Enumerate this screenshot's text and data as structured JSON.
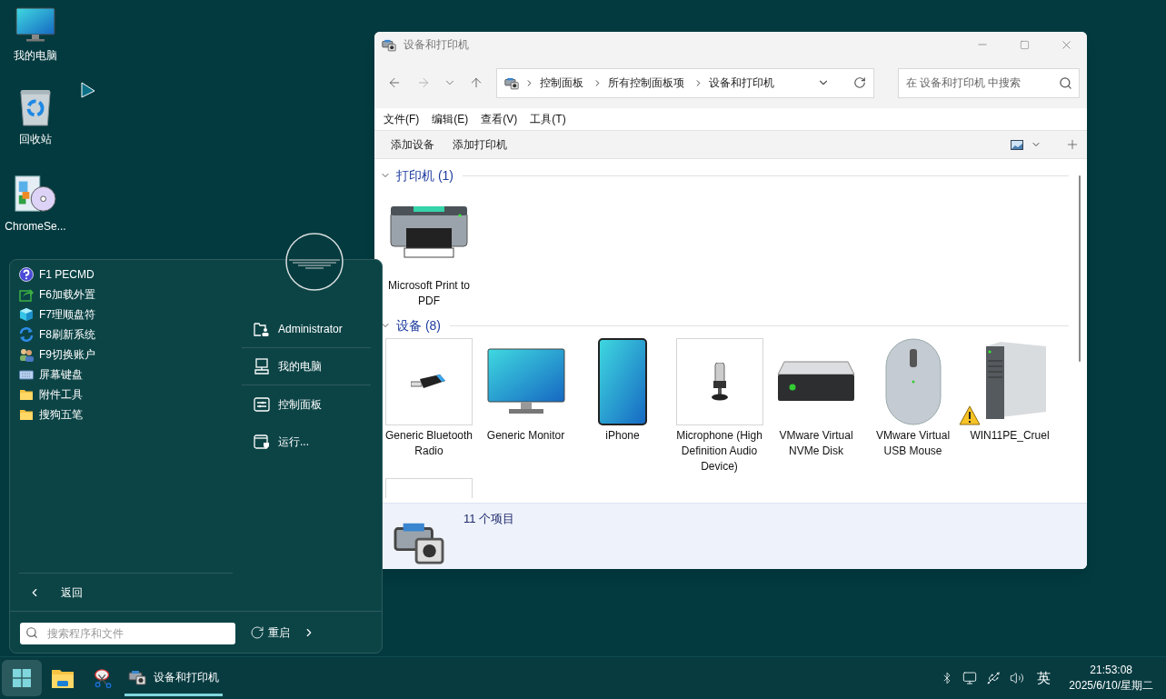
{
  "desktop_icons": [
    {
      "label": "我的电脑",
      "kind": "monitor"
    },
    {
      "label": "回收站",
      "kind": "bin"
    },
    {
      "label": "ChromeSe...",
      "kind": "setup"
    }
  ],
  "start_menu": {
    "programs": [
      {
        "label": "F1 PECMD",
        "kind": "help"
      },
      {
        "label": "F6加载外置",
        "kind": "share"
      },
      {
        "label": "F7理顺盘符",
        "kind": "cube"
      },
      {
        "label": "F8刷新系统",
        "kind": "refresh"
      },
      {
        "label": "F9切换账户",
        "kind": "users"
      },
      {
        "label": "屏幕键盘",
        "kind": "keyboard"
      },
      {
        "label": "附件工具",
        "kind": "folder"
      },
      {
        "label": "搜狗五笔",
        "kind": "folder"
      }
    ],
    "links": [
      {
        "label": "Administrator",
        "kind": "user-folder"
      },
      {
        "label": "我的电脑",
        "kind": "computer"
      },
      {
        "label": "控制面板",
        "kind": "panel"
      },
      {
        "label": "运行...",
        "kind": "run"
      }
    ],
    "back": "返回",
    "search": {
      "placeholder": "搜索程序和文件"
    },
    "restart": "重启"
  },
  "window": {
    "title": "设备和打印机",
    "breadcrumbs": [
      "控制面板",
      "所有控制面板项",
      "设备和打印机"
    ],
    "search": {
      "placeholder": "在 设备和打印机 中搜索"
    },
    "menu": [
      "文件(F)",
      "编辑(E)",
      "查看(V)",
      "工具(T)"
    ],
    "toolbar": [
      "添加设备",
      "添加打印机"
    ],
    "groups": [
      {
        "title": "打印机 (1)",
        "expanded": true,
        "items": [
          {
            "name": "Microsoft Print to PDF",
            "kind": "printer",
            "warning": false
          }
        ]
      },
      {
        "title": "设备 (8)",
        "expanded": true,
        "items": [
          {
            "name": "Generic Bluetooth Radio",
            "kind": "bluetooth",
            "warning": false
          },
          {
            "name": "Generic Monitor",
            "kind": "monitor",
            "warning": false
          },
          {
            "name": "iPhone",
            "kind": "phone",
            "warning": false
          },
          {
            "name": "Microphone (High Definition Audio Device)",
            "kind": "microphone",
            "warning": false
          },
          {
            "name": "VMware Virtual NVMe Disk",
            "kind": "disk",
            "warning": false
          },
          {
            "name": "VMware Virtual USB Mouse",
            "kind": "mouse",
            "warning": false
          },
          {
            "name": "WIN11PE_Cruel",
            "kind": "server",
            "warning": true
          },
          {
            "kind": "cut-tile"
          }
        ]
      }
    ],
    "status": "11 个项目"
  },
  "taskbar": {
    "apps": [
      {
        "kind": "start",
        "selected": true
      },
      {
        "kind": "folder",
        "selected": false
      },
      {
        "kind": "snip",
        "selected": false
      },
      {
        "kind": "devices",
        "label": "设备和打印机",
        "selected": true
      }
    ],
    "ime": "英",
    "time": "21:53:08",
    "date": "2025/6/10/星期二"
  }
}
